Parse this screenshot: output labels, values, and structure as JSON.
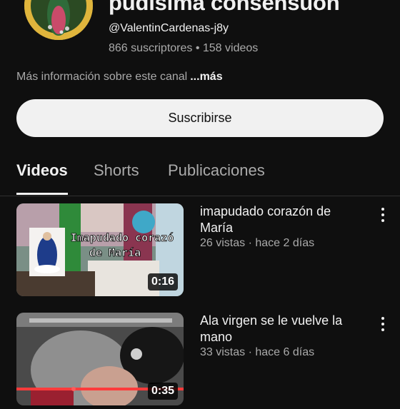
{
  "channel": {
    "name": "pudisima consensuon",
    "handle": "@ValentinCardenas-j8y",
    "stats": "866 suscriptores • 158 videos",
    "about": "Más información sobre este canal",
    "about_more": "...más",
    "subscribe_label": "Suscribirse"
  },
  "tabs": [
    {
      "label": "Videos",
      "active": true
    },
    {
      "label": "Shorts",
      "active": false
    },
    {
      "label": "Publicaciones",
      "active": false
    }
  ],
  "videos": [
    {
      "title": "imapudado corazón de María",
      "meta": "26 vistas · hace 2 días",
      "duration": "0:16",
      "overlay_text_1": "Imapudado corazó",
      "overlay_text_2": "de María"
    },
    {
      "title": "Ala virgen se le vuelve la mano",
      "meta": "33 vistas · hace 6 días",
      "duration": "0:35"
    }
  ],
  "colors": {
    "background": "#0f0f0f",
    "text": "#f1f1f1",
    "secondary": "#aaaaaa",
    "button": "#f1f1f1"
  },
  "icons": [
    "more-vert-icon"
  ]
}
